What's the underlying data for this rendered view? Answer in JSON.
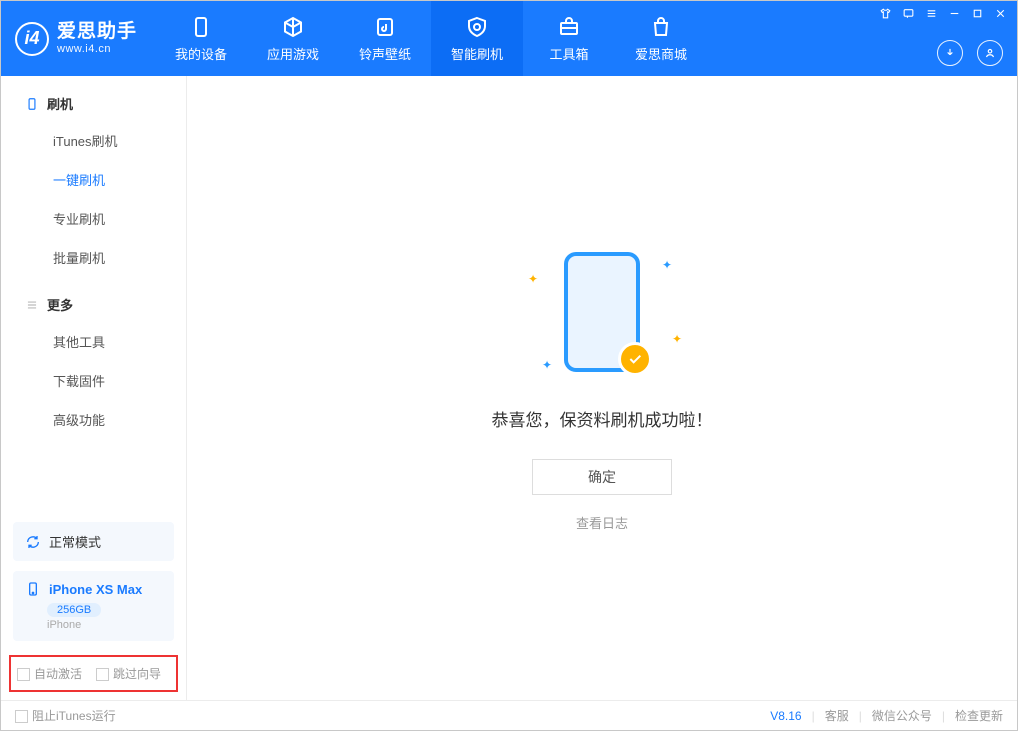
{
  "app": {
    "name": "爱思助手",
    "url": "www.i4.cn"
  },
  "nav": {
    "items": [
      {
        "label": "我的设备"
      },
      {
        "label": "应用游戏"
      },
      {
        "label": "铃声壁纸"
      },
      {
        "label": "智能刷机"
      },
      {
        "label": "工具箱"
      },
      {
        "label": "爱思商城"
      }
    ]
  },
  "sidebar": {
    "section1": {
      "title": "刷机",
      "items": [
        "iTunes刷机",
        "一键刷机",
        "专业刷机",
        "批量刷机"
      ]
    },
    "section2": {
      "title": "更多",
      "items": [
        "其他工具",
        "下载固件",
        "高级功能"
      ]
    },
    "mode_label": "正常模式",
    "device_name": "iPhone XS Max",
    "device_storage": "256GB",
    "device_brand": "iPhone",
    "opt1": "自动激活",
    "opt2": "跳过向导"
  },
  "main": {
    "success_text": "恭喜您，保资料刷机成功啦！",
    "ok_label": "确定",
    "log_link": "查看日志"
  },
  "footer": {
    "stop_itunes": "阻止iTunes运行",
    "version": "V8.16",
    "links": [
      "客服",
      "微信公众号",
      "检查更新"
    ]
  }
}
